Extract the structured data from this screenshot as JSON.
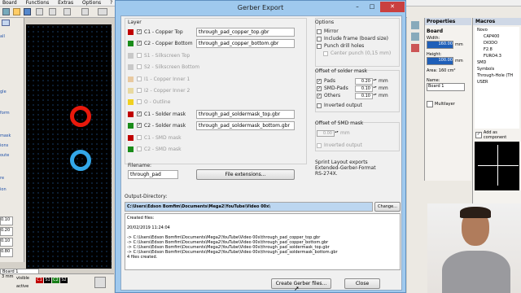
{
  "app": {
    "menu": [
      "Board",
      "Functions",
      "Extras",
      "Options",
      "?"
    ],
    "side_labels": [
      "all",
      "gle",
      "form",
      "mask",
      "ions",
      "oute",
      "re",
      "ion"
    ],
    "num_fields": [
      "0.10",
      "0.20",
      "0.10",
      "0.80"
    ],
    "board_tab": "Board 1",
    "visible_label": "visible",
    "active_label": "active",
    "mm_label": "3 mm",
    "layer_chips": [
      {
        "label": "C1",
        "color": "#c00000"
      },
      {
        "label": "S1",
        "color": "#000000"
      },
      {
        "label": "C2",
        "color": "#1a7f1a"
      },
      {
        "label": "S2",
        "color": "#000000"
      }
    ],
    "pad_colors": {
      "red": "#e8190c",
      "blue": "#33a7e8"
    }
  },
  "properties": {
    "title": "Properties",
    "section": "Board",
    "width_label": "Width:",
    "width_value": "160.00",
    "height_label": "Height:",
    "height_value": "100.00",
    "unit": "mm",
    "area_label": "Area:",
    "area_value": "160 cm²",
    "name_label": "Name:",
    "name_value": "Board 1",
    "multilayer_label": "Multilayer"
  },
  "macros": {
    "title": "Macros",
    "tree": [
      "Novo",
      "CAP400",
      "DIODO",
      "F2.8",
      "FURO4.3",
      "SMD",
      "Symbols",
      "Through-Hole (TH",
      "USER"
    ],
    "add_component": "Add as component"
  },
  "dialog": {
    "title": "Gerber Export",
    "layer_header": "Layer",
    "layers": [
      {
        "label": "C1 - Copper Top",
        "checked": true,
        "enabled": true,
        "color": "#c00000",
        "file": "through_pad_copper_top.gbr"
      },
      {
        "label": "C2 - Copper Bottom",
        "checked": true,
        "enabled": true,
        "color": "#1a8c1a",
        "file": "through_pad_copper_bottom.gbr"
      },
      {
        "label": "S1 - Silkscreen Top",
        "checked": false,
        "enabled": false,
        "color": "#c8c8c8",
        "file": ""
      },
      {
        "label": "S2 - Silkscreen Bottom",
        "checked": false,
        "enabled": false,
        "color": "#c8c8c8",
        "file": ""
      },
      {
        "label": "I1 - Copper Inner 1",
        "checked": false,
        "enabled": false,
        "color": "#e8c9a0",
        "file": ""
      },
      {
        "label": "I2 - Copper Inner 2",
        "checked": false,
        "enabled": false,
        "color": "#e8d9a0",
        "file": ""
      },
      {
        "label": "O - Outline",
        "checked": false,
        "enabled": false,
        "color": "#f0d020",
        "file": ""
      },
      {
        "label": "C1 - Solder mask",
        "checked": true,
        "enabled": true,
        "color": "#c00000",
        "file": "through_pad_soldermask_top.gbr"
      },
      {
        "label": "C2 - Solder mask",
        "checked": true,
        "enabled": true,
        "color": "#1a8c1a",
        "file": "through_pad_soldermask_bottom.gbr"
      },
      {
        "label": "C1 - SMD mask",
        "checked": false,
        "enabled": false,
        "color": "#c00000",
        "file": ""
      },
      {
        "label": "C2 - SMD mask",
        "checked": false,
        "enabled": false,
        "color": "#1a8c1a",
        "file": ""
      }
    ],
    "filename_label": "Filename:",
    "filename_value": "through_pad",
    "file_ext_button": "File extensions...",
    "options_header": "Options",
    "mirror_label": "Mirror",
    "include_frame_label": "Include frame (board size)",
    "punch_label": "Punch drill holes",
    "center_punch_label": "Center punch (0,15 mm)",
    "offset_solder_header": "Offset of solder mask",
    "pads_label": "Pads",
    "pads_value": "0.20",
    "smdpads_label": "SMD-Pads",
    "smdpads_value": "0.10",
    "others_label": "Others",
    "others_value": "0.10",
    "mm": "mm",
    "inverted_label": "Inverted output",
    "offset_smd_header": "Offset of SMD mask",
    "smd_value": "0.00",
    "inverted_label2": "Inverted output",
    "info_line1": "Sprint Layout exports",
    "info_line2": "Extended-Gerber-Format",
    "info_line3": "RS-274X.",
    "output_dir_label": "Output-Directory:",
    "output_dir_value": "C:\\Users\\Edson Bomfim\\Documents\\Mega2\\YouTube\\Video 00x\\",
    "change_button": "Change...",
    "log_lines": [
      "Created files:",
      "",
      "20/02/2019 11:24:04",
      "",
      "-> C:\\Users\\Edson Bomfim\\Documents\\Mega2\\YouTube\\Video 00x\\through_pad_copper_top.gbr",
      "-> C:\\Users\\Edson Bomfim\\Documents\\Mega2\\YouTube\\Video 00x\\through_pad_copper_bottom.gbr",
      "-> C:\\Users\\Edson Bomfim\\Documents\\Mega2\\YouTube\\Video 00x\\through_pad_soldermask_top.gbr",
      "-> C:\\Users\\Edson Bomfim\\Documents\\Mega2\\YouTube\\Video 00x\\through_pad_soldermask_bottom.gbr",
      "4 files created."
    ],
    "create_button": "Create Gerber files...",
    "close_button": "Close",
    "win_min": "–",
    "win_max": "□",
    "win_close": "✕"
  }
}
